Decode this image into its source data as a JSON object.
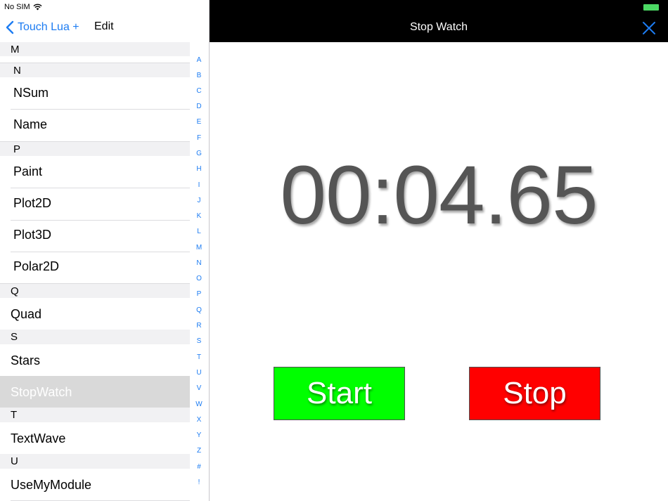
{
  "status_bar": {
    "carrier": "No SIM",
    "wifi_icon": "wifi-icon",
    "battery_icon": "battery-icon",
    "battery_color": "#4cd964"
  },
  "master_nav": {
    "back_label": "Touch Lua +",
    "back_icon": "chevron-left-icon",
    "edit_label": "Edit"
  },
  "sections": [
    {
      "header": "M",
      "items": []
    },
    {
      "header": "N",
      "items": [
        {
          "label": "NSum"
        },
        {
          "label": "Name"
        }
      ]
    },
    {
      "header": "P",
      "items": [
        {
          "label": "Paint"
        },
        {
          "label": "Plot2D"
        },
        {
          "label": "Plot3D"
        },
        {
          "label": "Polar2D"
        }
      ]
    },
    {
      "header": "Q",
      "items": [
        {
          "label": "Quad"
        }
      ]
    },
    {
      "header": "S",
      "items": [
        {
          "label": "Stars"
        },
        {
          "label": "StopWatch",
          "selected": true
        }
      ]
    },
    {
      "header": "T",
      "items": [
        {
          "label": "TextWave"
        }
      ]
    },
    {
      "header": "U",
      "items": [
        {
          "label": "UseMyModule"
        }
      ]
    }
  ],
  "section_index": [
    "A",
    "B",
    "C",
    "D",
    "E",
    "F",
    "G",
    "H",
    "I",
    "J",
    "K",
    "L",
    "M",
    "N",
    "O",
    "P",
    "Q",
    "R",
    "S",
    "T",
    "U",
    "V",
    "W",
    "X",
    "Y",
    "Z",
    "#",
    "!"
  ],
  "detail": {
    "title": "Stop Watch",
    "close_icon": "close-icon",
    "timer": "00:04.65",
    "start_button": {
      "label": "Start",
      "color": "#00ff00"
    },
    "stop_button": {
      "label": "Stop",
      "color": "#ff0000"
    }
  },
  "colors": {
    "accent": "#1d7cf2",
    "nav_bar": "#000000",
    "timer_text": "#555555",
    "selected_row": "#d9d9d9",
    "section_header": "#f1f1f3"
  }
}
